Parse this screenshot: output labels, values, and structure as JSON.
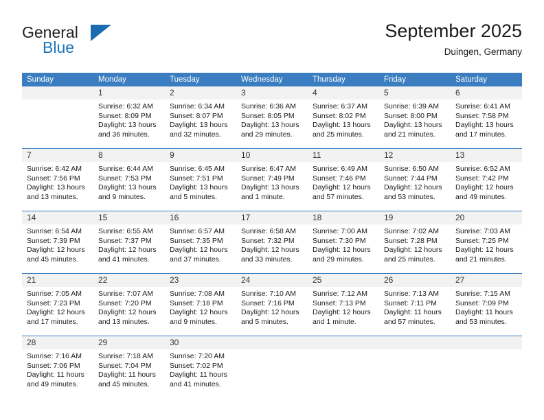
{
  "logo": {
    "text_primary": "General",
    "text_secondary": "Blue",
    "triangle_color": "#1b6cb0"
  },
  "header": {
    "title": "September 2025",
    "subtitle": "Duingen, Germany"
  },
  "colors": {
    "header_row_bg": "#3a7dc0",
    "day_number_bg": "#f2f2f2",
    "row_divider": "#3a7dc0",
    "logo_blue": "#1b75bb"
  },
  "weekdays": [
    "Sunday",
    "Monday",
    "Tuesday",
    "Wednesday",
    "Thursday",
    "Friday",
    "Saturday"
  ],
  "weeks": [
    [
      {
        "day": "",
        "blank": true,
        "sunrise": "",
        "sunset": "",
        "daylight": ""
      },
      {
        "day": "1",
        "sunrise": "Sunrise: 6:32 AM",
        "sunset": "Sunset: 8:09 PM",
        "daylight": "Daylight: 13 hours and 36 minutes."
      },
      {
        "day": "2",
        "sunrise": "Sunrise: 6:34 AM",
        "sunset": "Sunset: 8:07 PM",
        "daylight": "Daylight: 13 hours and 32 minutes."
      },
      {
        "day": "3",
        "sunrise": "Sunrise: 6:36 AM",
        "sunset": "Sunset: 8:05 PM",
        "daylight": "Daylight: 13 hours and 29 minutes."
      },
      {
        "day": "4",
        "sunrise": "Sunrise: 6:37 AM",
        "sunset": "Sunset: 8:02 PM",
        "daylight": "Daylight: 13 hours and 25 minutes."
      },
      {
        "day": "5",
        "sunrise": "Sunrise: 6:39 AM",
        "sunset": "Sunset: 8:00 PM",
        "daylight": "Daylight: 13 hours and 21 minutes."
      },
      {
        "day": "6",
        "sunrise": "Sunrise: 6:41 AM",
        "sunset": "Sunset: 7:58 PM",
        "daylight": "Daylight: 13 hours and 17 minutes."
      }
    ],
    [
      {
        "day": "7",
        "sunrise": "Sunrise: 6:42 AM",
        "sunset": "Sunset: 7:56 PM",
        "daylight": "Daylight: 13 hours and 13 minutes."
      },
      {
        "day": "8",
        "sunrise": "Sunrise: 6:44 AM",
        "sunset": "Sunset: 7:53 PM",
        "daylight": "Daylight: 13 hours and 9 minutes."
      },
      {
        "day": "9",
        "sunrise": "Sunrise: 6:45 AM",
        "sunset": "Sunset: 7:51 PM",
        "daylight": "Daylight: 13 hours and 5 minutes."
      },
      {
        "day": "10",
        "sunrise": "Sunrise: 6:47 AM",
        "sunset": "Sunset: 7:49 PM",
        "daylight": "Daylight: 13 hours and 1 minute."
      },
      {
        "day": "11",
        "sunrise": "Sunrise: 6:49 AM",
        "sunset": "Sunset: 7:46 PM",
        "daylight": "Daylight: 12 hours and 57 minutes."
      },
      {
        "day": "12",
        "sunrise": "Sunrise: 6:50 AM",
        "sunset": "Sunset: 7:44 PM",
        "daylight": "Daylight: 12 hours and 53 minutes."
      },
      {
        "day": "13",
        "sunrise": "Sunrise: 6:52 AM",
        "sunset": "Sunset: 7:42 PM",
        "daylight": "Daylight: 12 hours and 49 minutes."
      }
    ],
    [
      {
        "day": "14",
        "sunrise": "Sunrise: 6:54 AM",
        "sunset": "Sunset: 7:39 PM",
        "daylight": "Daylight: 12 hours and 45 minutes."
      },
      {
        "day": "15",
        "sunrise": "Sunrise: 6:55 AM",
        "sunset": "Sunset: 7:37 PM",
        "daylight": "Daylight: 12 hours and 41 minutes."
      },
      {
        "day": "16",
        "sunrise": "Sunrise: 6:57 AM",
        "sunset": "Sunset: 7:35 PM",
        "daylight": "Daylight: 12 hours and 37 minutes."
      },
      {
        "day": "17",
        "sunrise": "Sunrise: 6:58 AM",
        "sunset": "Sunset: 7:32 PM",
        "daylight": "Daylight: 12 hours and 33 minutes."
      },
      {
        "day": "18",
        "sunrise": "Sunrise: 7:00 AM",
        "sunset": "Sunset: 7:30 PM",
        "daylight": "Daylight: 12 hours and 29 minutes."
      },
      {
        "day": "19",
        "sunrise": "Sunrise: 7:02 AM",
        "sunset": "Sunset: 7:28 PM",
        "daylight": "Daylight: 12 hours and 25 minutes."
      },
      {
        "day": "20",
        "sunrise": "Sunrise: 7:03 AM",
        "sunset": "Sunset: 7:25 PM",
        "daylight": "Daylight: 12 hours and 21 minutes."
      }
    ],
    [
      {
        "day": "21",
        "sunrise": "Sunrise: 7:05 AM",
        "sunset": "Sunset: 7:23 PM",
        "daylight": "Daylight: 12 hours and 17 minutes."
      },
      {
        "day": "22",
        "sunrise": "Sunrise: 7:07 AM",
        "sunset": "Sunset: 7:20 PM",
        "daylight": "Daylight: 12 hours and 13 minutes."
      },
      {
        "day": "23",
        "sunrise": "Sunrise: 7:08 AM",
        "sunset": "Sunset: 7:18 PM",
        "daylight": "Daylight: 12 hours and 9 minutes."
      },
      {
        "day": "24",
        "sunrise": "Sunrise: 7:10 AM",
        "sunset": "Sunset: 7:16 PM",
        "daylight": "Daylight: 12 hours and 5 minutes."
      },
      {
        "day": "25",
        "sunrise": "Sunrise: 7:12 AM",
        "sunset": "Sunset: 7:13 PM",
        "daylight": "Daylight: 12 hours and 1 minute."
      },
      {
        "day": "26",
        "sunrise": "Sunrise: 7:13 AM",
        "sunset": "Sunset: 7:11 PM",
        "daylight": "Daylight: 11 hours and 57 minutes."
      },
      {
        "day": "27",
        "sunrise": "Sunrise: 7:15 AM",
        "sunset": "Sunset: 7:09 PM",
        "daylight": "Daylight: 11 hours and 53 minutes."
      }
    ],
    [
      {
        "day": "28",
        "sunrise": "Sunrise: 7:16 AM",
        "sunset": "Sunset: 7:06 PM",
        "daylight": "Daylight: 11 hours and 49 minutes."
      },
      {
        "day": "29",
        "sunrise": "Sunrise: 7:18 AM",
        "sunset": "Sunset: 7:04 PM",
        "daylight": "Daylight: 11 hours and 45 minutes."
      },
      {
        "day": "30",
        "sunrise": "Sunrise: 7:20 AM",
        "sunset": "Sunset: 7:02 PM",
        "daylight": "Daylight: 11 hours and 41 minutes."
      },
      {
        "day": "",
        "blank": true,
        "sunrise": "",
        "sunset": "",
        "daylight": ""
      },
      {
        "day": "",
        "blank": true,
        "sunrise": "",
        "sunset": "",
        "daylight": ""
      },
      {
        "day": "",
        "blank": true,
        "sunrise": "",
        "sunset": "",
        "daylight": ""
      },
      {
        "day": "",
        "blank": true,
        "sunrise": "",
        "sunset": "",
        "daylight": ""
      }
    ]
  ]
}
